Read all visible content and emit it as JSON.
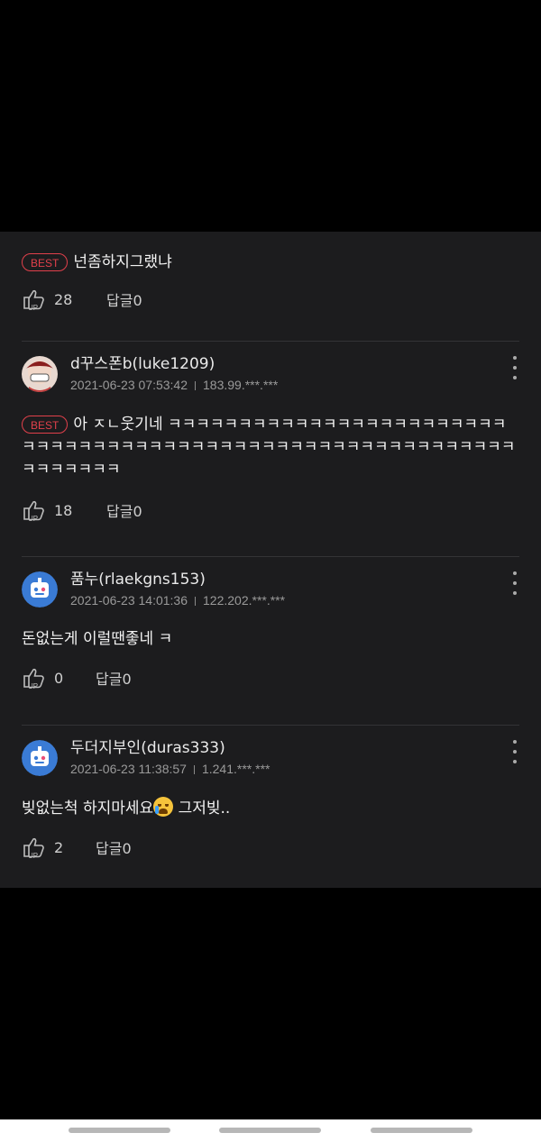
{
  "comments": [
    {
      "best": true,
      "best_label": "BEST",
      "text": "넌좀하지그랬냐",
      "likes": "28",
      "reply_label": "답글0"
    },
    {
      "username": "d꾸스폰b(luke1209)",
      "date": "2021-06-23 07:53:42",
      "ip": "183.99.***.***",
      "best": true,
      "best_label": "BEST",
      "text": "아 ㅈㄴ웃기네 ㅋㅋㅋㅋㅋㅋㅋㅋㅋㅋㅋㅋㅋㅋㅋㅋㅋㅋㅋㅋㅋㅋㅋㅋㅋㅋㅋㅋㅋㅋㅋㅋㅋㅋㅋㅋㅋㅋㅋㅋㅋㅋㅋㅋㅋㅋㅋㅋㅋㅋㅋㅋㅋㅋㅋㅋㅋㅋㅋㅋㅋㅋㅋㅋㅋㅋ",
      "likes": "18",
      "reply_label": "답글0"
    },
    {
      "username": "품누(rlaekgns153)",
      "date": "2021-06-23 14:01:36",
      "ip": "122.202.***.***",
      "text": "돈없는게 이럴땐좋네 ㅋ",
      "likes": "0",
      "reply_label": "답글0"
    },
    {
      "username": "두더지부인(duras333)",
      "date": "2021-06-23 11:38:57",
      "ip": "1.241.***.***",
      "text_before": "빚없는척 하지마세요",
      "emoji": "crying-face",
      "text_after": " 그저빚..",
      "likes": "2",
      "reply_label": "답글0"
    }
  ],
  "colors": {
    "best_red": "#e0404b",
    "panel_bg": "#1c1c1e",
    "page_bg": "#000000"
  }
}
